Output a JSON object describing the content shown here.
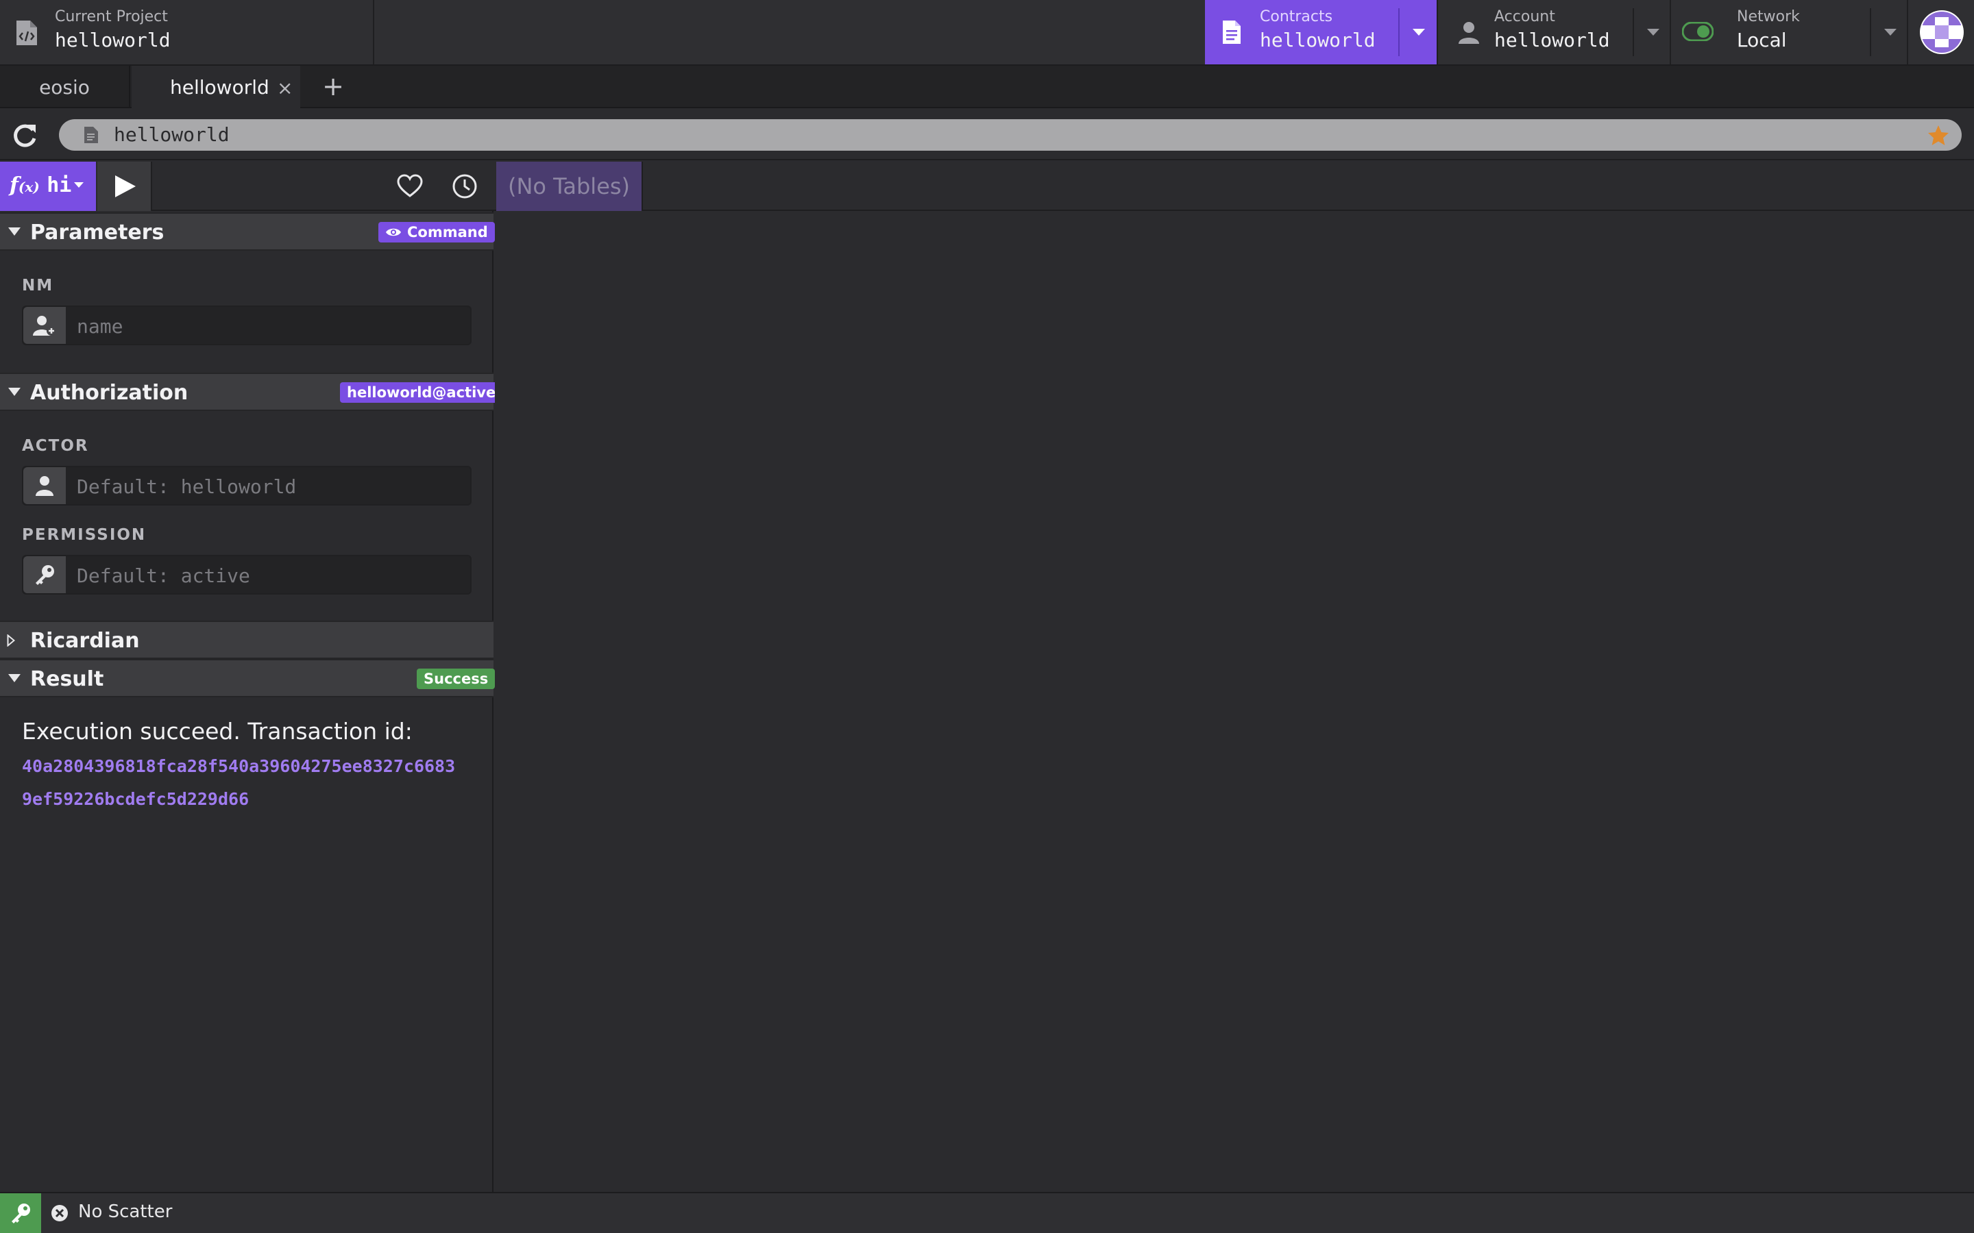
{
  "topbar": {
    "project": {
      "label": "Current Project",
      "value": "helloworld"
    },
    "contracts": {
      "label": "Contracts",
      "value": "helloworld"
    },
    "account": {
      "label": "Account",
      "value": "helloworld"
    },
    "network": {
      "label": "Network",
      "value": "Local"
    }
  },
  "tabs": [
    {
      "label": "eosio",
      "active": false
    },
    {
      "label": "helloworld",
      "active": true
    }
  ],
  "tab_close_glyph": "×",
  "tab_add_glyph": "+",
  "address": {
    "value": "helloworld"
  },
  "toolbar": {
    "function_label": "hi",
    "tables_label": "(No Tables)"
  },
  "parameters": {
    "title": "Parameters",
    "badge": "Command",
    "fields": [
      {
        "label": "NM",
        "placeholder": "name",
        "icon": "user-add-icon"
      }
    ]
  },
  "authorization": {
    "title": "Authorization",
    "badge": "helloworld@active",
    "actor": {
      "label": "ACTOR",
      "placeholder": "Default: helloworld",
      "icon": "user-icon"
    },
    "permission": {
      "label": "PERMISSION",
      "placeholder": "Default: active",
      "icon": "key-icon"
    }
  },
  "ricardian": {
    "title": "Ricardian"
  },
  "result": {
    "title": "Result",
    "badge": "Success",
    "message": "Execution succeed. Transaction id:",
    "txid_line_1": "40a2804396818fca28f540a39604275ee8327c6683",
    "txid_line_2": "9ef59226bcdefc5d229d66"
  },
  "status": {
    "scatter": "No Scatter"
  },
  "colors": {
    "accent": "#7a4ee3",
    "success": "#4e9b50",
    "star": "#e08a2c",
    "link": "#a07cf0"
  }
}
